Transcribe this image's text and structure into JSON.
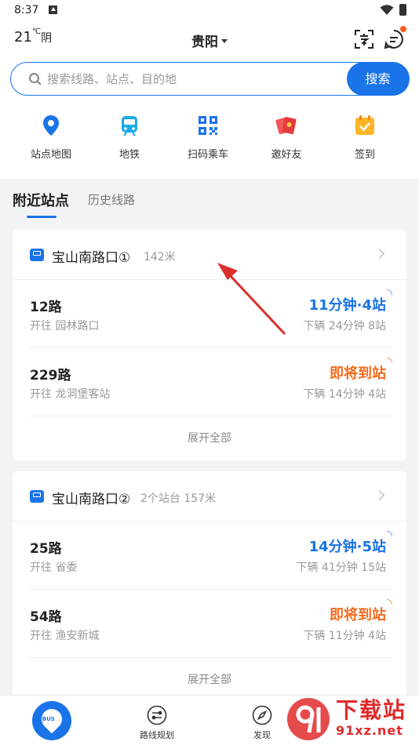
{
  "status_bar": {
    "time": "8:37"
  },
  "header": {
    "temperature": "21",
    "temp_unit": "℃",
    "condition": "阴",
    "city": "贵阳"
  },
  "search": {
    "placeholder": "搜索线路、站点、目的地",
    "button_label": "搜索"
  },
  "quick_actions": [
    {
      "label": "站点地图",
      "icon": "location-pin-icon"
    },
    {
      "label": "地铁",
      "icon": "subway-train-icon"
    },
    {
      "label": "扫码乘车",
      "icon": "qr-code-icon"
    },
    {
      "label": "邀好友",
      "icon": "red-envelope-icon"
    },
    {
      "label": "签到",
      "icon": "calendar-check-icon"
    }
  ],
  "tabs": [
    {
      "label": "附近站点",
      "active": true
    },
    {
      "label": "历史线路",
      "active": false
    }
  ],
  "stops": [
    {
      "name": "宝山南路口①",
      "meta": "142米",
      "routes": [
        {
          "name": "12路",
          "direction": "开往 园林路口",
          "eta": "11分钟·4站",
          "eta_color": "blue",
          "next": "下辆  24分钟 8站"
        },
        {
          "name": "229路",
          "direction": "开往 龙洞堡客站",
          "eta": "即将到站",
          "eta_color": "orange",
          "next": "下辆  14分钟 4站"
        }
      ],
      "expand_label": "展开全部"
    },
    {
      "name": "宝山南路口②",
      "meta": "2个站台 157米",
      "routes": [
        {
          "name": "25路",
          "direction": "开往 省委",
          "eta": "14分钟·5站",
          "eta_color": "blue",
          "next": "下辆  41分钟 15站"
        },
        {
          "name": "54路",
          "direction": "开往 渔安新城",
          "eta": "即将到站",
          "eta_color": "orange",
          "next": "下辆  11分钟 4站"
        }
      ],
      "expand_label": "展开全部"
    }
  ],
  "bottom_nav": [
    {
      "label": "",
      "icon": "bus-pin-icon",
      "active": true
    },
    {
      "label": "路线规划",
      "icon": "route-plan-icon"
    },
    {
      "label": "发现",
      "icon": "compass-icon"
    }
  ],
  "watermark": {
    "title": "下载站",
    "url": "91xz.net"
  },
  "colors": {
    "accent": "#1a73e8",
    "arriving": "#f26b1d",
    "watermark": "#e02b2b"
  }
}
